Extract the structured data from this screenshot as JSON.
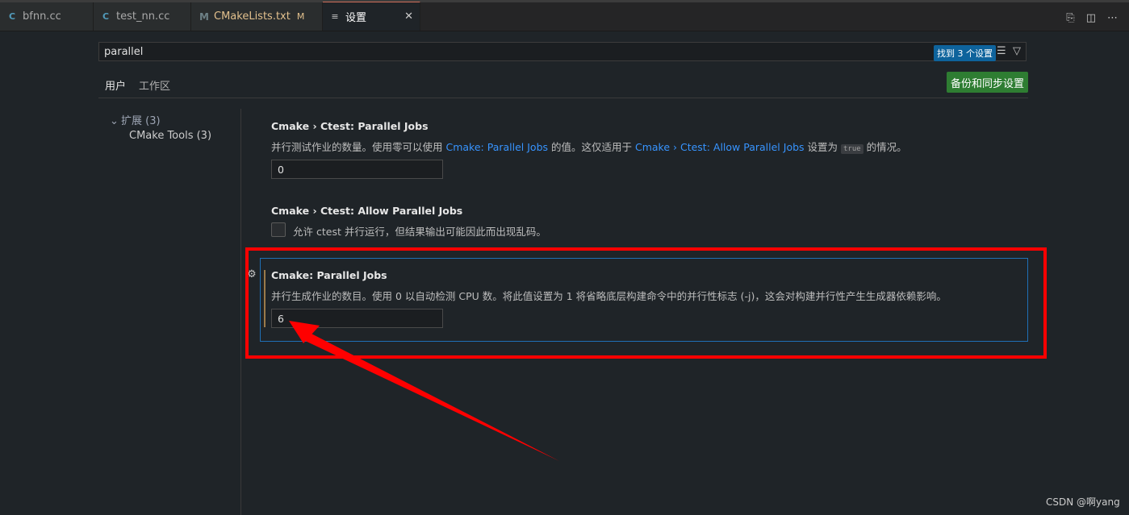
{
  "tabs": [
    {
      "icon": "C",
      "label": "bfnn.cc"
    },
    {
      "icon": "C",
      "label": "test_nn.cc"
    },
    {
      "icon": "M",
      "label": "CMakeLists.txt",
      "flag": "M"
    },
    {
      "icon": "≡",
      "label": "设置",
      "close": "✕"
    }
  ],
  "toolbar_icons": [
    "open-json-icon",
    "split-editor-icon",
    "more-actions-icon"
  ],
  "search": {
    "value": "parallel",
    "count_label": "找到 3 个设置"
  },
  "scope_tabs": {
    "user": "用户",
    "workspace": "工作区"
  },
  "sync_button": "备份和同步设置",
  "toc": {
    "group": "扩展 (3)",
    "item": "CMake Tools (3)"
  },
  "settings": {
    "s1": {
      "title": "Cmake › Ctest: Parallel Jobs",
      "d1": "并行测试作业的数量。使用零可以使用 ",
      "link1": "Cmake: Parallel Jobs",
      "d2": " 的值。这仅适用于 ",
      "link2": "Cmake › Ctest: Allow Parallel Jobs",
      "d3": " 设置为 ",
      "code": "true",
      "d4": " 的情况。",
      "value": "0"
    },
    "s2": {
      "title": "Cmake › Ctest: Allow Parallel Jobs",
      "desc": "允许 ctest 并行运行，但结果输出可能因此而出现乱码。",
      "checked": false
    },
    "s3": {
      "title": "Cmake: Parallel Jobs",
      "desc": "并行生成作业的数目。使用 0 以自动检测 CPU 数。将此值设置为 1 将省略底层构建命令中的并行性标志 (-j)，这会对构建并行性产生生成器依赖影响。",
      "value": "6"
    }
  },
  "watermark": "CSDN @啊yang",
  "colors": {
    "accent": "#0e639c",
    "sync": "#2e7d32",
    "annotation": "#ff0000",
    "link": "#3794ff"
  }
}
